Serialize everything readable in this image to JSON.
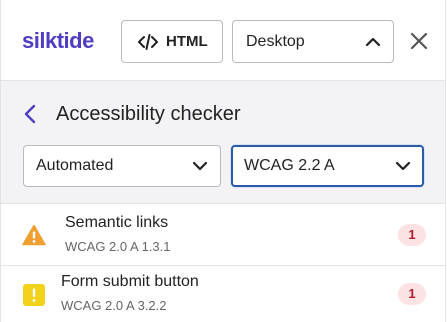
{
  "brand": {
    "logo_text": "silktide",
    "logo_color": "#4f3ec2"
  },
  "topbar": {
    "html_button_label": "HTML",
    "html_button_icon": "code-icon",
    "device_select_value": "Desktop",
    "device_select_icon": "chevron-up-icon",
    "close_icon": "close-icon"
  },
  "header": {
    "back_icon": "chevron-left-icon",
    "title": "Accessibility checker",
    "mode_select_value": "Automated",
    "level_select_value": "WCAG 2.2 A"
  },
  "issues": [
    {
      "name": "Semantic links",
      "reference": "WCAG 2.0 A 1.3.1",
      "count": "1",
      "icon": "warning-triangle-icon",
      "icon_color": "#f0a030"
    },
    {
      "name": "Form submit button",
      "reference": "WCAG 2.0 A 3.2.2",
      "count": "1",
      "icon": "alert-square-icon",
      "icon_color": "#f3d21b"
    }
  ],
  "colors": {
    "accent": "#4f3ec2",
    "focus_border": "#2b5aa6",
    "count_badge_bg": "#fde2e4",
    "count_badge_text": "#b01e2e"
  }
}
